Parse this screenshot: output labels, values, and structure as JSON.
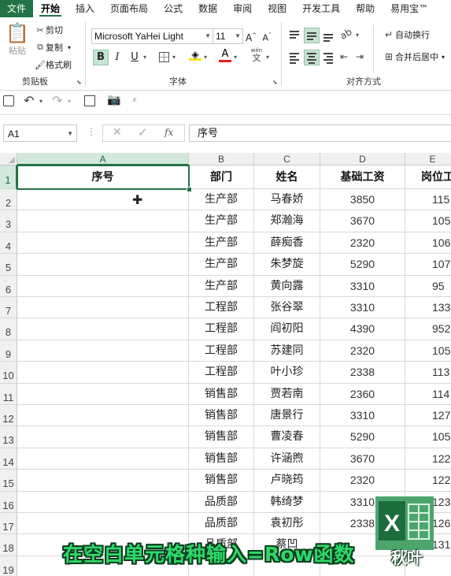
{
  "tabs": [
    "文件",
    "开始",
    "插入",
    "页面布局",
    "公式",
    "数据",
    "审阅",
    "视图",
    "开发工具",
    "帮助",
    "易用宝™"
  ],
  "ribbon": {
    "clipboard": {
      "paste": "粘贴",
      "cut": "剪切",
      "copy": "复制",
      "format_painter": "格式刷",
      "label": "剪贴板"
    },
    "font": {
      "name": "Microsoft YaHei Light",
      "size": "11",
      "grow": "A^",
      "shrink": "A˅",
      "bold": "B",
      "italic": "I",
      "underline": "U",
      "font_color_letter": "A",
      "phonetic": "wén",
      "label": "字体"
    },
    "alignment": {
      "wrap": "自动换行",
      "merge": "合并后居中",
      "label": "对齐方式"
    }
  },
  "formula_bar": {
    "name_box": "A1",
    "fx": "fx",
    "content": "序号"
  },
  "columns": [
    "A",
    "B",
    "C",
    "D",
    "E"
  ],
  "rows": [
    "1",
    "2",
    "3",
    "4",
    "5",
    "6",
    "7",
    "8",
    "9",
    "10",
    "11",
    "12",
    "13",
    "14",
    "15",
    "16",
    "17",
    "18",
    "19"
  ],
  "headers": [
    "序号",
    "部门",
    "姓名",
    "基础工资",
    "岗位工"
  ],
  "data": [
    [
      "生产部",
      "马春娇",
      "3850",
      "115"
    ],
    [
      "生产部",
      "郑瀚海",
      "3670",
      "105"
    ],
    [
      "生产部",
      "薛痴香",
      "2320",
      "106"
    ],
    [
      "生产部",
      "朱梦旋",
      "5290",
      "107"
    ],
    [
      "生产部",
      "黄向露",
      "3310",
      "95"
    ],
    [
      "工程部",
      "张谷翠",
      "3310",
      "133"
    ],
    [
      "工程部",
      "阎初阳",
      "4390",
      "952"
    ],
    [
      "工程部",
      "苏建同",
      "2320",
      "105"
    ],
    [
      "工程部",
      "叶小珍",
      "2338",
      "113"
    ],
    [
      "销售部",
      "贾若南",
      "2360",
      "114"
    ],
    [
      "销售部",
      "唐景行",
      "3310",
      "127"
    ],
    [
      "销售部",
      "曹凌春",
      "5290",
      "105"
    ],
    [
      "销售部",
      "许涵煦",
      "3670",
      "122"
    ],
    [
      "销售部",
      "卢晓筠",
      "2320",
      "122"
    ],
    [
      "品质部",
      "韩绮梦",
      "3310",
      "123"
    ],
    [
      "品质部",
      "袁初彤",
      "2338",
      "126"
    ],
    [
      "品质部",
      "蔡凹",
      "",
      "131"
    ]
  ],
  "caption": "在空白单元格种输入=Row函数",
  "logo_text": "秋叶",
  "colors": {
    "accent": "#217346",
    "caption": "#2fd86a"
  }
}
